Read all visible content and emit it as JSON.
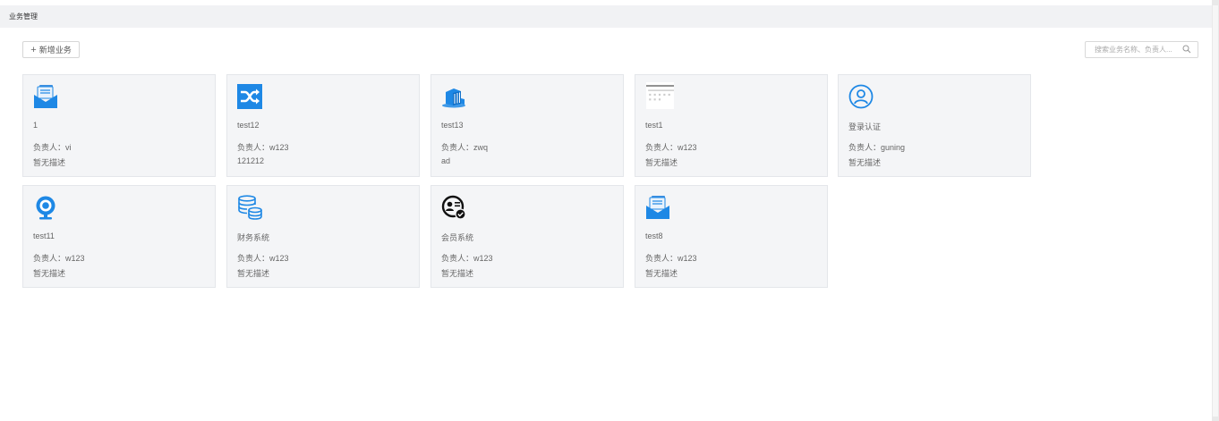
{
  "header": {
    "title": "业务管理"
  },
  "toolbar": {
    "add_label": "新增业务",
    "add_icon": "plus"
  },
  "search": {
    "placeholder": "搜索业务名称、负责人...",
    "icon": "search-icon"
  },
  "colors": {
    "accent": "#1e88e5",
    "card_bg": "#f4f5f7"
  },
  "owner_prefix": "负责人：",
  "cards": [
    {
      "name": "1",
      "owner": "负责人：vi",
      "desc": "暂无描述",
      "icon": "mail-envelope-icon"
    },
    {
      "name": "test12",
      "owner": "负责人：w123",
      "desc": "121212",
      "icon": "shuffle-icon"
    },
    {
      "name": "test13",
      "owner": "负责人：zwq",
      "desc": "ad",
      "icon": "container-icon"
    },
    {
      "name": "test1",
      "owner": "负责人：w123",
      "desc": "暂无描述",
      "icon": "image-thumbnail-icon"
    },
    {
      "name": "登录认证",
      "owner": "负责人：guning",
      "desc": "暂无描述",
      "icon": "user-icon"
    },
    {
      "name": "test11",
      "owner": "负责人：w123",
      "desc": "暂无描述",
      "icon": "webcam-icon"
    },
    {
      "name": "财务系统",
      "owner": "负责人：w123",
      "desc": "暂无描述",
      "icon": "database-icon"
    },
    {
      "name": "会员系统",
      "owner": "负责人：w123",
      "desc": "暂无描述",
      "icon": "member-badge-icon"
    },
    {
      "name": "test8",
      "owner": "负责人：w123",
      "desc": "暂无描述",
      "icon": "mail-envelope-icon"
    }
  ]
}
